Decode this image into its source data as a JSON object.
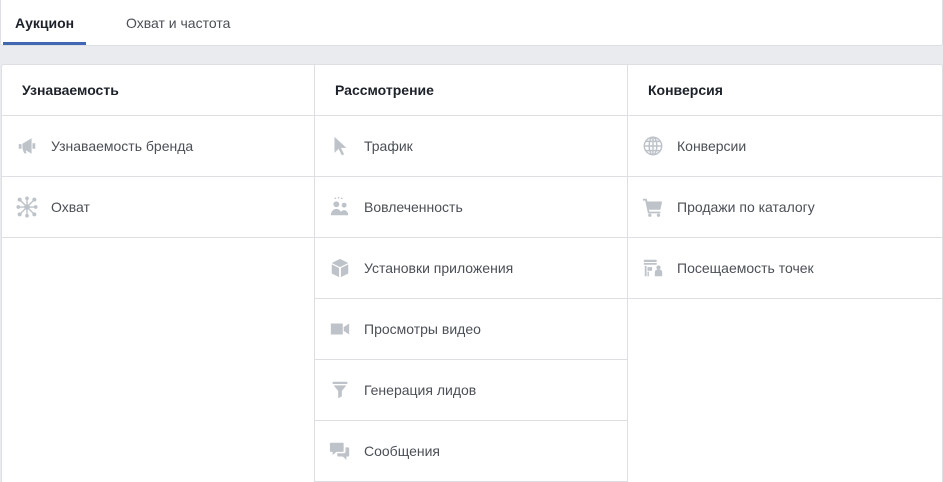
{
  "tabs": [
    {
      "label": "Аукцион",
      "active": true
    },
    {
      "label": "Охват и частота",
      "active": false
    }
  ],
  "columns": [
    {
      "header": "Узнаваемость",
      "items": [
        {
          "label": "Узнаваемость бренда",
          "icon": "megaphone-icon"
        },
        {
          "label": "Охват",
          "icon": "reach-icon"
        }
      ]
    },
    {
      "header": "Рассмотрение",
      "items": [
        {
          "label": "Трафик",
          "icon": "cursor-icon"
        },
        {
          "label": "Вовлеченность",
          "icon": "people-icon"
        },
        {
          "label": "Установки приложения",
          "icon": "cube-icon"
        },
        {
          "label": "Просмотры видео",
          "icon": "video-camera-icon"
        },
        {
          "label": "Генерация лидов",
          "icon": "funnel-icon"
        },
        {
          "label": "Сообщения",
          "icon": "chat-bubbles-icon"
        }
      ]
    },
    {
      "header": "Конверсия",
      "items": [
        {
          "label": "Конверсии",
          "icon": "globe-icon"
        },
        {
          "label": "Продажи по каталогу",
          "icon": "cart-icon"
        },
        {
          "label": "Посещаемость точек",
          "icon": "store-icon"
        }
      ]
    }
  ],
  "colors": {
    "accent": "#4267b2",
    "icon": "#bec3c9",
    "border": "#dddfe2"
  }
}
